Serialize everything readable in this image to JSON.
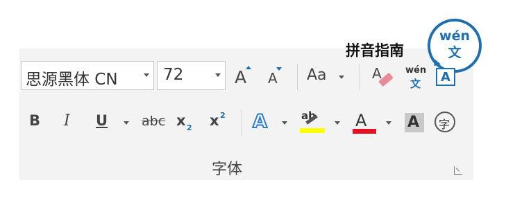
{
  "ribbon": {
    "font_name": "思源黑体 CN",
    "font_size": "72",
    "grow_font_glyph": "A",
    "shrink_font_glyph": "A",
    "change_case_label": "Aa",
    "phonetic_top": "wén",
    "phonetic_bottom": "文",
    "enclosed_char_glyph": "A",
    "bold_label": "B",
    "italic_label": "I",
    "underline_label": "U",
    "strikethrough_label": "abc",
    "subscript_label": "x",
    "subscript_mark": "2",
    "superscript_label": "x",
    "superscript_mark": "2",
    "text_effect_glyph": "A",
    "highlight_glyph": "ab",
    "font_color_glyph": "A",
    "char_shading_glyph": "A",
    "enclose_glyph": "字",
    "group_label": "字体"
  },
  "callout": {
    "label": "拼音指南",
    "icon_top": "wén",
    "icon_bottom": "文"
  },
  "colors": {
    "accent_blue": "#1e6fae",
    "highlight_yellow": "#ffff00",
    "font_red": "#e81123",
    "panel_bg": "#f3f3f3"
  }
}
